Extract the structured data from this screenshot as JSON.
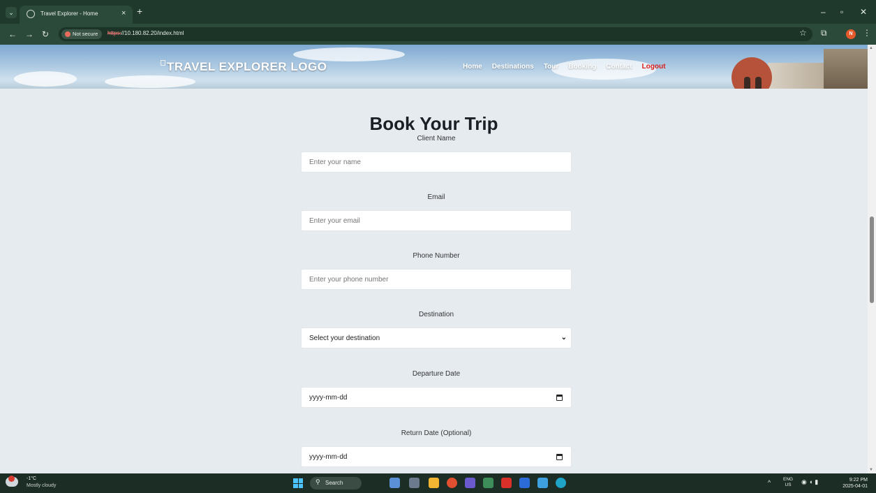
{
  "browser": {
    "tab_title": "Travel Explorer - Home",
    "close_glyph": "×",
    "new_tab_glyph": "+",
    "security_label": "Not secure",
    "url_protocol": "https:",
    "url_rest": "//10.180.82.20/index.html",
    "icons": [
      "tab-search-icon",
      "site-icon",
      "back-icon",
      "forward-icon",
      "reload-icon",
      "bookmark-star-icon",
      "extensions-icon",
      "profile-avatar",
      "menu-icon",
      "minimize-icon",
      "restore-icon",
      "close-icon"
    ],
    "profile_initial": "N"
  },
  "header": {
    "logo_text": "TRAVEL EXPLORER LOGO",
    "nav": [
      "Home",
      "Destinations",
      "Tour",
      "Booking",
      "Contact",
      "Logout"
    ],
    "logout_color": "#d9201c"
  },
  "form": {
    "title": "Book Your Trip",
    "client_name": {
      "label": "Client Name",
      "placeholder": "Enter your name"
    },
    "email": {
      "label": "Email",
      "placeholder": "Enter your email"
    },
    "phone": {
      "label": "Phone Number",
      "placeholder": "Enter your phone number"
    },
    "destination": {
      "label": "Destination",
      "selected": "Select your destination"
    },
    "departure": {
      "label": "Departure Date",
      "value": "yyyy-mm-dd"
    },
    "return": {
      "label": "Return Date (Optional)",
      "value": "yyyy-mm-dd"
    }
  },
  "taskbar": {
    "weather_temp": "-1°C",
    "weather_desc": "Mostly cloudy",
    "search_label": "Search",
    "lang_top": "ENG",
    "lang_bottom": "US",
    "time": "9:22 PM",
    "date": "2025-04-01",
    "app_colors": [
      "#5b8fd6",
      "#6b7a8c",
      "#f2b632",
      "#e04f2f",
      "#6a5acd",
      "#3c8d5a",
      "#d9302a",
      "#2b6cd8",
      "#3fa0e0",
      "#1fa3c7"
    ]
  }
}
